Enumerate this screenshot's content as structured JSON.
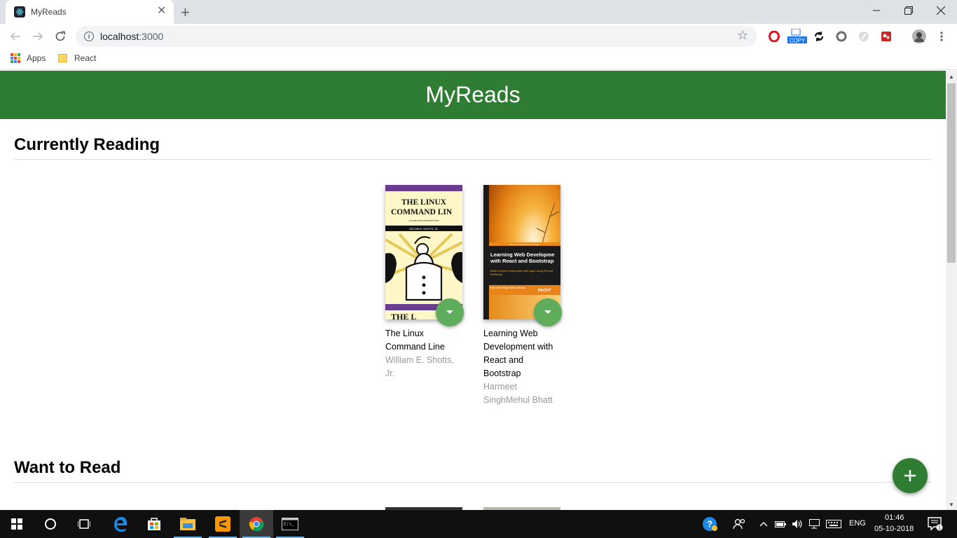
{
  "browser": {
    "tab_title": "MyReads",
    "url_host": "localhost",
    "url_port": ":3000",
    "bookmarks": [
      {
        "label": "Apps"
      },
      {
        "label": "React"
      }
    ],
    "extensions": [
      "opera-icon",
      "copy-icon",
      "sync-icon",
      "circle-icon",
      "feather-icon",
      "puzzle-icon",
      "profile-avatar"
    ],
    "copy_badge": "COPY"
  },
  "app": {
    "title": "MyReads",
    "accent_color": "#2e7d32",
    "changer_color": "#60ac5d"
  },
  "shelves": [
    {
      "title": "Currently Reading",
      "books": [
        {
          "title": "The Linux Command Line",
          "authors": "William E. Shotts, Jr.",
          "cover": {
            "heading_line1": "THE LINUX",
            "heading_line2": "COMMAND LIN",
            "subtitle": "A COMPLETE INTRODUCTION",
            "author_strip": "WILLIAM E. SHOTTS, JR.",
            "bottom_text": "THE L"
          }
        },
        {
          "title": "Learning Web Development with React and Bootstrap",
          "authors": "Harmeet SinghMehul Bhatt",
          "cover": {
            "band": "Community Experience Distilled",
            "heading": "Learning Web Developme with React and Bootstrap",
            "sub": "Build real-time responsive web apps using Re and Bootstrap",
            "authors": "Harmeet Singh Mehul Bhatt",
            "publisher": "PACKT"
          }
        }
      ]
    },
    {
      "title": "Want to Read",
      "books": []
    }
  ],
  "taskbar": {
    "language": "ENG",
    "time": "01:46",
    "date": "05-10-2018",
    "notification_count": "1"
  }
}
